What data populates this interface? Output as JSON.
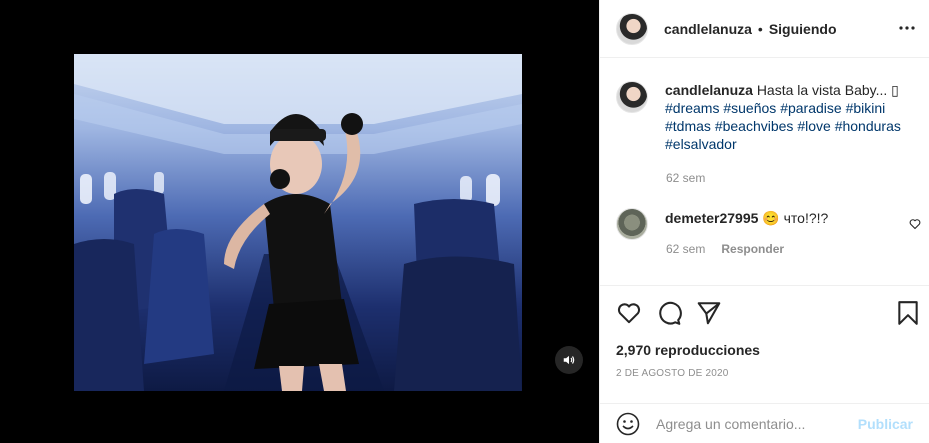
{
  "post": {
    "username": "candlelanuza",
    "separator": "•",
    "follow_status": "Siguiendo",
    "more_label": "•••",
    "caption": {
      "text": "Hasta la vista Baby... ",
      "emoji": "▯",
      "hashtags": [
        "#dreams",
        "#sueños",
        "#paradise",
        "#bikini",
        "#tdmas",
        "#beachvibes",
        "#love",
        "#honduras",
        "#elsalvador"
      ],
      "time": "62 sem"
    },
    "comments": [
      {
        "username": "demeter27995",
        "text": "😊 что!?!?",
        "time": "62 sem",
        "reply_label": "Responder"
      }
    ],
    "views": "2,970 reproducciones",
    "date": "2 DE AGOSTO DE 2020",
    "add_comment": {
      "placeholder": "Agrega un comentario...",
      "publish_label": "Publicar"
    }
  },
  "icons": {
    "mute": "speaker-icon",
    "like": "heart-icon",
    "comment": "comment-bubble-icon",
    "share": "paper-plane-icon",
    "save": "bookmark-icon",
    "emoji": "smiley-icon",
    "comment_like": "heart-icon"
  },
  "colors": {
    "hashtag": "#00376b",
    "secondary_text": "#8e8e8e",
    "publish_disabled": "#b2dffc",
    "border": "#efefef"
  }
}
